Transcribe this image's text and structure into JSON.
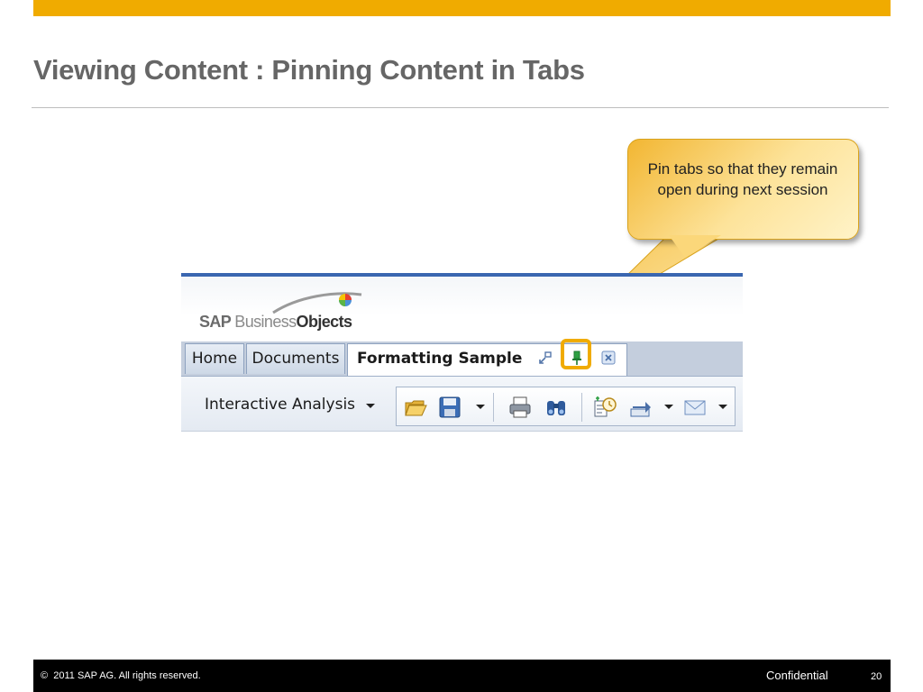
{
  "slide": {
    "title": "Viewing Content : Pinning Content in Tabs",
    "accent_color": "#f0ab00"
  },
  "callout": {
    "text": "Pin tabs so that they remain open during next session"
  },
  "app": {
    "logo": {
      "sap": "SAP ",
      "business": "Business",
      "objects": "Objects"
    },
    "tabs": [
      {
        "label": "Home",
        "active": false
      },
      {
        "label": "Documents",
        "active": false
      },
      {
        "label": "Formatting Sample",
        "active": true
      }
    ],
    "tab_icons": [
      "restore-icon",
      "pin-icon",
      "close-icon"
    ],
    "toolbar": {
      "app_label": "Interactive Analysis",
      "icons": [
        "open-folder-icon",
        "save-icon",
        "print-icon",
        "find-icon",
        "schedule-icon",
        "send-to-icon",
        "email-icon"
      ]
    },
    "colors": {
      "tab_bar": "#c4cedd",
      "header_line": "#3a66b0",
      "pin_green": "#2ea043"
    }
  },
  "footer": {
    "copyright_symbol": "©",
    "copyright": "2011 SAP AG. All rights reserved.",
    "confidential": "Confidential",
    "page": "20"
  }
}
